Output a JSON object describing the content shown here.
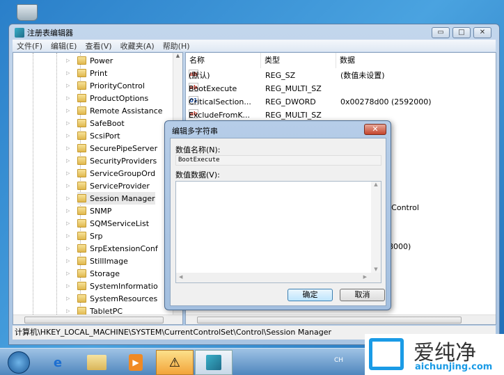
{
  "window": {
    "title": "注册表编辑器",
    "min": "▭",
    "max": "□",
    "close": "✕"
  },
  "menu": [
    "文件(F)",
    "编辑(E)",
    "查看(V)",
    "收藏夹(A)",
    "帮助(H)"
  ],
  "tree": {
    "items": [
      "Power",
      "Print",
      "PriorityControl",
      "ProductOptions",
      "Remote Assistance",
      "SafeBoot",
      "ScsiPort",
      "SecurePipeServer",
      "SecurityProviders",
      "ServiceGroupOrd",
      "ServiceProvider",
      "Session Manager",
      "SNMP",
      "SQMServiceList",
      "Srp",
      "SrpExtensionConf",
      "StillImage",
      "Storage",
      "SystemInformatio",
      "SystemResources",
      "TabletPC"
    ],
    "selected": "Session Manager"
  },
  "list": {
    "headers": [
      "名称",
      "类型",
      "数据"
    ],
    "rows": [
      {
        "name": "(默认)",
        "type": "REG_SZ",
        "data": "(数值未设置)",
        "icon": "ab"
      },
      {
        "name": "BootExecute",
        "type": "REG_MULTI_SZ",
        "data": "",
        "icon": "ab"
      },
      {
        "name": "CriticalSection...",
        "type": "REG_DWORD",
        "data": "0x00278d00 (2592000)",
        "icon": "bin"
      },
      {
        "name": "ExcludeFromK...",
        "type": "REG_MULTI_SZ",
        "data": "",
        "icon": "ab"
      }
    ],
    "partial_data": [
      ")",
      ")",
      ")",
      ")",
      ")",
      ")",
      "C Control",
      ")",
      ")",
      "48000)"
    ]
  },
  "status": "计算机\\HKEY_LOCAL_MACHINE\\SYSTEM\\CurrentControlSet\\Control\\Session Manager",
  "dialog": {
    "title": "编辑多字符串",
    "name_label": "数值名称(N):",
    "name_value": "BootExecute",
    "data_label": "数值数据(V):",
    "data_value": "",
    "ok": "确定",
    "cancel": "取消"
  },
  "taskbar": {
    "tray_lang": "CH"
  },
  "watermark": {
    "brand": "爱纯净",
    "url": "aichunjing.com"
  }
}
